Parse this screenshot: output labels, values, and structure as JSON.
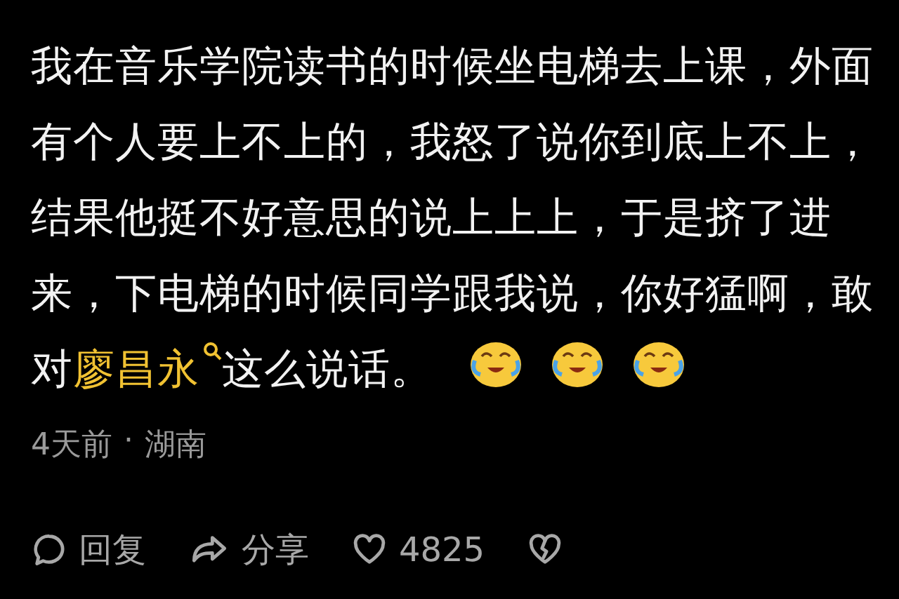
{
  "comment": {
    "segments": [
      {
        "kind": "text",
        "text": "我在音乐学院读书的时候坐电梯去上课，外面有个人要上不上的，我怒了说你到底上不上，结果他挺不好意思的说上上上，于是挤了进来，下电梯的时候同学跟我说，你好猛啊，敢对"
      },
      {
        "kind": "mention",
        "text": "廖昌永"
      },
      {
        "kind": "text",
        "text": "这么说话。"
      }
    ],
    "emojis": [
      {
        "kind": "laugh-cry"
      },
      {
        "kind": "laugh-cry"
      },
      {
        "kind": "laugh-cry"
      }
    ],
    "time": "4天前",
    "separator": "·",
    "location": "湖南"
  },
  "actions": [
    {
      "kind": "reply",
      "label": "回复"
    },
    {
      "kind": "share",
      "label": "分享"
    },
    {
      "kind": "like",
      "label": "4825",
      "liked": false
    },
    {
      "kind": "dislike"
    }
  ]
}
